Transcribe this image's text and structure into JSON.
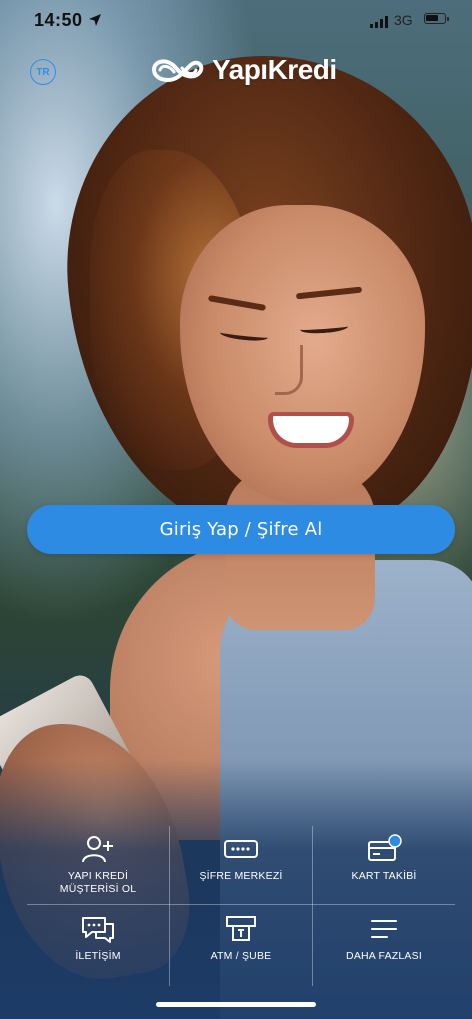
{
  "status_bar": {
    "time": "14:50",
    "network": "3G"
  },
  "header": {
    "language": "TR",
    "logo_text": "YapıKredi"
  },
  "login": {
    "label": "Giriş Yap / Şifre Al"
  },
  "quick_actions": [
    {
      "icon": "add-user-icon",
      "label": "YAPI KREDİ MÜŞTERİSİ OL"
    },
    {
      "icon": "password-icon",
      "label": "ŞİFRE MERKEZİ"
    },
    {
      "icon": "card-tracking-icon",
      "label": "KART TAKİBİ"
    },
    {
      "icon": "chat-icon",
      "label": "İLETİŞİM"
    },
    {
      "icon": "atm-icon",
      "label": "ATM / ŞUBE"
    },
    {
      "icon": "menu-icon",
      "label": "DAHA FAZLASI"
    }
  ],
  "colors": {
    "accent": "#2e8be3",
    "lang_accent": "#2f8fe6"
  }
}
